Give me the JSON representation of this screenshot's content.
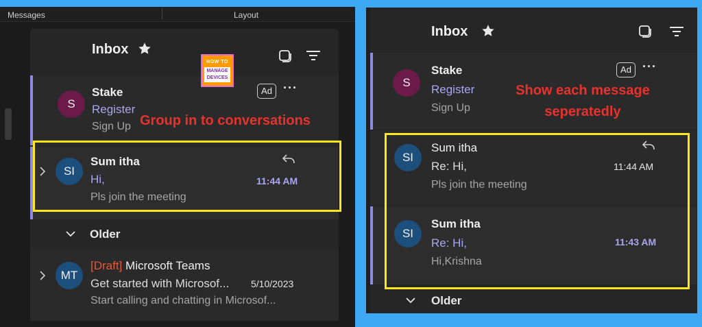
{
  "left": {
    "menu": {
      "messages": "Messages",
      "layout": "Layout"
    },
    "inbox_title": "Inbox",
    "logo": {
      "line1": "HOW TO",
      "line2": "MANAGE DEVICES"
    },
    "callout": "Group in to conversations",
    "messages": [
      {
        "avatar": "S",
        "avatar_color": "#6b1a4a",
        "sender": "Stake",
        "subject": "Register",
        "preview": "Sign Up",
        "badge": "Ad",
        "more": "···"
      },
      {
        "avatar": "SI",
        "avatar_color": "#1d4f7d",
        "sender": "Sum itha",
        "subject": "Hi,",
        "preview": "Pls join the meeting",
        "time": "11:44 AM"
      }
    ],
    "older_label": "Older",
    "older_messages": [
      {
        "avatar": "MT",
        "avatar_color": "#1d4f7d",
        "draft": "[Draft]",
        "sender": "Microsoft Teams",
        "subject": "Get started with Microsof...",
        "time": "5/10/2023",
        "preview": "Start calling and chatting in Microsof..."
      }
    ]
  },
  "right": {
    "inbox_title": "Inbox",
    "callout": "Show each message seperatedly",
    "messages": [
      {
        "avatar": "S",
        "avatar_color": "#6b1a4a",
        "sender": "Stake",
        "subject": "Register",
        "preview": "Sign Up",
        "badge": "Ad",
        "more": "···"
      },
      {
        "avatar": "SI",
        "avatar_color": "#1d4f7d",
        "sender": "Sum itha",
        "subject": "Re: Hi,",
        "preview": "Pls join the meeting",
        "time": "11:44 AM"
      },
      {
        "avatar": "SI",
        "avatar_color": "#1d4f7d",
        "sender": "Sum itha",
        "subject": "Re: Hi,",
        "preview": "Hi,Krishna",
        "time": "11:43 AM"
      }
    ],
    "older_label": "Older"
  },
  "colors": {
    "accent": "#8e8ae0",
    "highlight": "#ffe81a",
    "callout": "#e8322d",
    "background": "#3ea8f2"
  },
  "icons": [
    "star-icon",
    "layout-icon",
    "filter-icon",
    "reply-icon",
    "chevron-right-icon",
    "chevron-down-icon"
  ]
}
